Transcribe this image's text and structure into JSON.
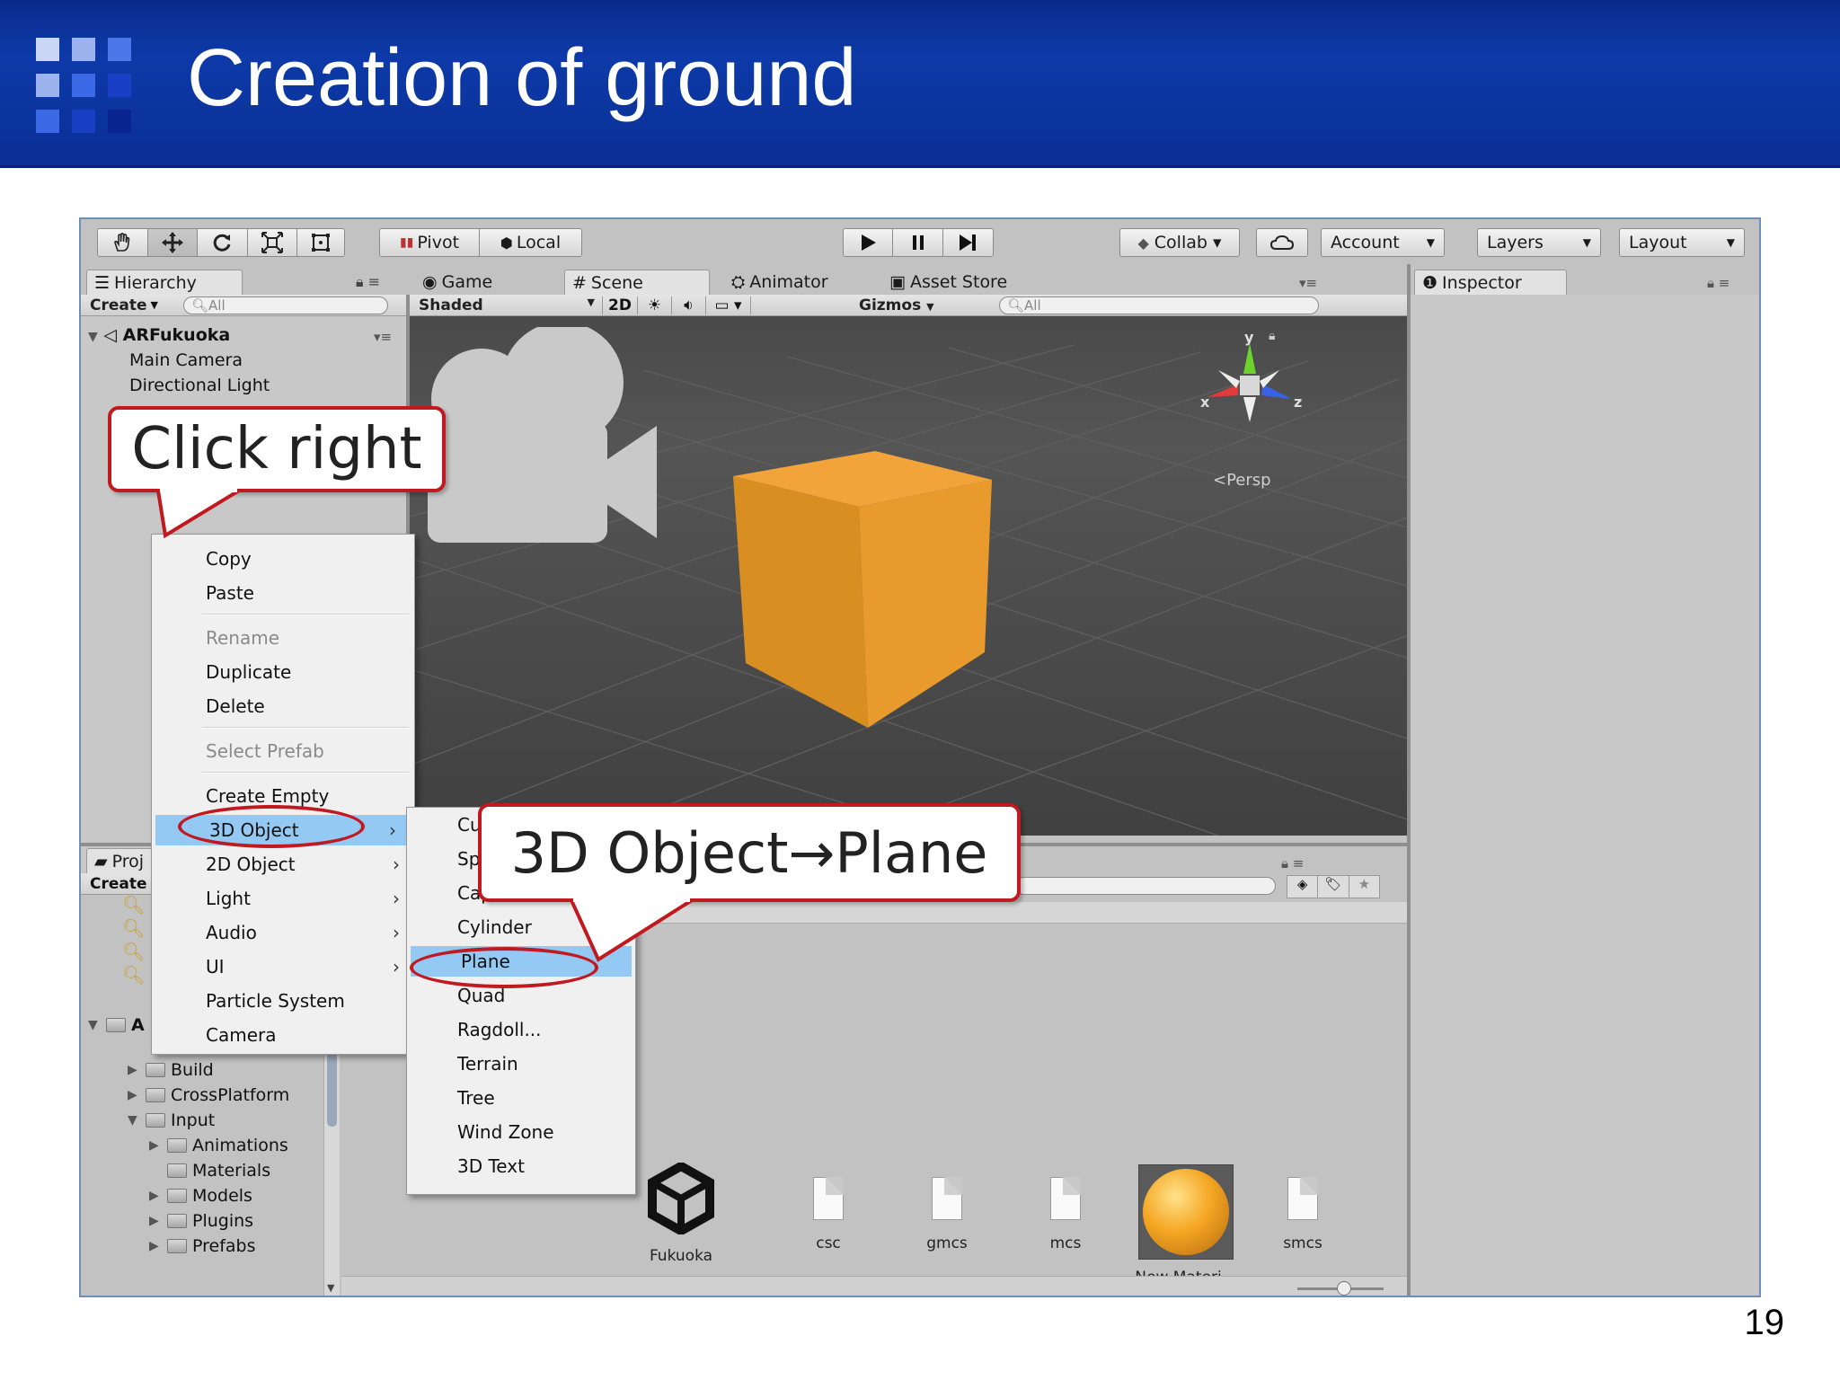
{
  "slide": {
    "title": "Creation of ground",
    "page_number": "19"
  },
  "colors": {
    "header_blue": "#0a2f95",
    "callout_red": "#c0191f",
    "highlight_blue": "#93c9f2",
    "cube_orange": "#f0a030"
  },
  "toolbar": {
    "tools": [
      "hand-icon",
      "move-icon",
      "rotate-icon",
      "scale-icon",
      "rect-icon"
    ],
    "pivot": "Pivot",
    "local": "Local",
    "collab": "Collab ▾",
    "account": "Account",
    "layers": "Layers",
    "layout": "Layout"
  },
  "hierarchy": {
    "tab": "Hierarchy",
    "create": "Create",
    "search_placeholder": "All",
    "scene_name": "ARFukuoka",
    "items": [
      "Main Camera",
      "Directional Light"
    ]
  },
  "view_tabs": {
    "game": "Game",
    "scene": "Scene",
    "animator": "Animator",
    "asset_store": "Asset Store"
  },
  "scene_bar": {
    "shading": "Shaded",
    "mode_2d": "2D",
    "gizmos": "Gizmos",
    "search_placeholder": "All"
  },
  "gizmo": {
    "y": "y",
    "x": "x",
    "z": "z",
    "persp": "Persp"
  },
  "inspector": {
    "tab": "Inspector"
  },
  "project": {
    "tab": "Proj",
    "create": "Create",
    "root": "A"
  },
  "project_tree": [
    {
      "label": "Build",
      "depth": 1,
      "expanded": false
    },
    {
      "label": "CrossPlatform",
      "depth": 1,
      "expanded": false
    },
    {
      "label": "Input",
      "depth": 1,
      "expanded": true
    },
    {
      "label": "Animations",
      "depth": 2,
      "expanded": false
    },
    {
      "label": "Materials",
      "depth": 2,
      "expanded": null
    },
    {
      "label": "Models",
      "depth": 2,
      "expanded": false
    },
    {
      "label": "Plugins",
      "depth": 2,
      "expanded": false
    },
    {
      "label": "Prefabs",
      "depth": 2,
      "expanded": false
    }
  ],
  "assets": [
    "Fukuoka",
    "csc",
    "gmcs",
    "mcs",
    "New Materi…",
    "smcs"
  ],
  "context_menu": {
    "items": [
      "Copy",
      "Paste",
      "Rename",
      "Duplicate",
      "Delete",
      "Select Prefab",
      "Create Empty",
      "3D Object",
      "2D Object",
      "Light",
      "Audio",
      "UI",
      "Particle System",
      "Camera"
    ],
    "disabled": [
      "Rename",
      "Select Prefab"
    ],
    "selected": "3D Object"
  },
  "submenu": {
    "items": [
      "Cu",
      "Sp",
      "Capsule",
      "Cylinder",
      "Plane",
      "Quad",
      "Ragdoll...",
      "Terrain",
      "Tree",
      "Wind Zone",
      "3D Text"
    ],
    "selected": "Plane"
  },
  "callouts": {
    "click_right": "Click right",
    "plane": "3D Object→Plane"
  }
}
